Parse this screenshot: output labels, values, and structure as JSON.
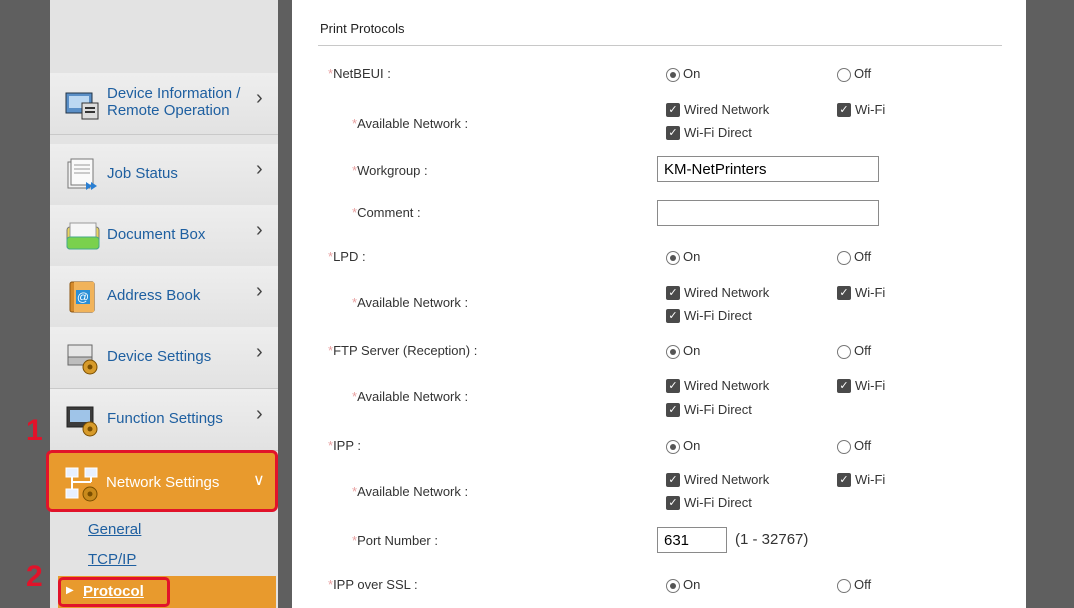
{
  "sidebar": {
    "items": [
      {
        "label_line1": "Device Information /",
        "label_line2": "Remote Operation",
        "icon": "device-info-icon"
      },
      {
        "label": "Job Status",
        "icon": "job-status-icon"
      },
      {
        "label": "Document Box",
        "icon": "document-box-icon"
      },
      {
        "label": "Address Book",
        "icon": "address-book-icon"
      },
      {
        "label": "Device Settings",
        "icon": "device-settings-icon"
      },
      {
        "label": "Function Settings",
        "icon": "function-settings-icon"
      },
      {
        "label": "Network Settings",
        "icon": "network-settings-icon",
        "expanded": true
      }
    ],
    "sub_items": [
      {
        "label": "General"
      },
      {
        "label": "TCP/IP"
      },
      {
        "label": "Protocol",
        "selected": true
      }
    ]
  },
  "steps": [
    "1",
    "2"
  ],
  "content": {
    "section_title": "Print Protocols",
    "asterisk": "*",
    "netbeui": {
      "label": "NetBEUI :",
      "on": "On",
      "off": "Off",
      "state": "On",
      "available_label": "Available Network :",
      "wired": "Wired Network",
      "wifi": "Wi-Fi",
      "wifi_direct": "Wi-Fi Direct",
      "workgroup_label": "Workgroup :",
      "workgroup_value": "KM-NetPrinters",
      "comment_label": "Comment :",
      "comment_value": ""
    },
    "lpd": {
      "label": "LPD :",
      "on": "On",
      "off": "Off",
      "state": "On",
      "available_label": "Available Network :",
      "wired": "Wired Network",
      "wifi": "Wi-Fi",
      "wifi_direct": "Wi-Fi Direct"
    },
    "ftp": {
      "label": "FTP Server (Reception) :",
      "on": "On",
      "off": "Off",
      "state": "On",
      "available_label": "Available Network :",
      "wired": "Wired Network",
      "wifi": "Wi-Fi",
      "wifi_direct": "Wi-Fi Direct"
    },
    "ipp": {
      "label": "IPP :",
      "on": "On",
      "off": "Off",
      "state": "On",
      "available_label": "Available Network :",
      "wired": "Wired Network",
      "wifi": "Wi-Fi",
      "wifi_direct": "Wi-Fi Direct",
      "port_label": "Port Number :",
      "port_value": "631",
      "port_range": "(1 - 32767)"
    },
    "ipp_ssl": {
      "label": "IPP over SSL :",
      "on": "On",
      "off": "Off",
      "state": "On"
    }
  },
  "colors": {
    "accent_orange": "#e89a2d",
    "highlight_red": "#e1132a",
    "link_blue": "#1e5fa0"
  }
}
